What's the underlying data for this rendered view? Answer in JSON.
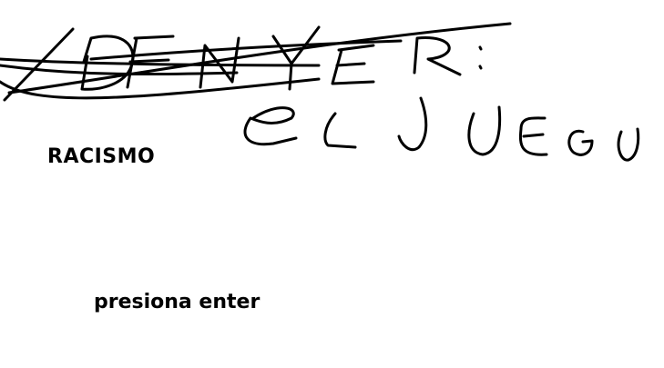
{
  "title_crossed_out": "DENVER:",
  "title_handwritten": "EL JUEGO",
  "subtitle": "RACISMO",
  "prompt": "presiona enter",
  "colors": {
    "background": "#ffffff",
    "ink": "#000000"
  }
}
